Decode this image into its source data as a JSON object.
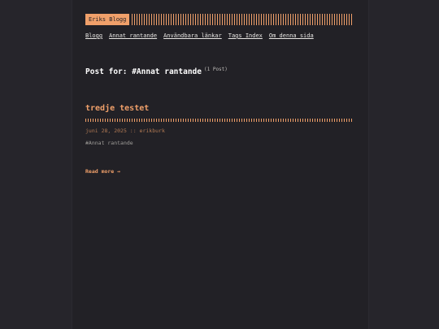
{
  "header": {
    "logo_text": "Eriks Blogg"
  },
  "nav": {
    "items": [
      {
        "label": "Blogg"
      },
      {
        "label": "Annat rantande"
      },
      {
        "label": "Användbara länkar"
      },
      {
        "label": "Tags Index"
      },
      {
        "label": "Om denna sida"
      }
    ]
  },
  "listing": {
    "title": "Post for: #Annat rantande",
    "count": "(1 Post)"
  },
  "post": {
    "title": "tredje testet",
    "date": "juni 28, 2025",
    "separator": "::",
    "author": "erikburk",
    "tag": "#Annat rantande",
    "read_more": "Read more →"
  },
  "colors": {
    "accent": "#f0a06a",
    "background": "#222126",
    "text": "#e8e6e3"
  }
}
